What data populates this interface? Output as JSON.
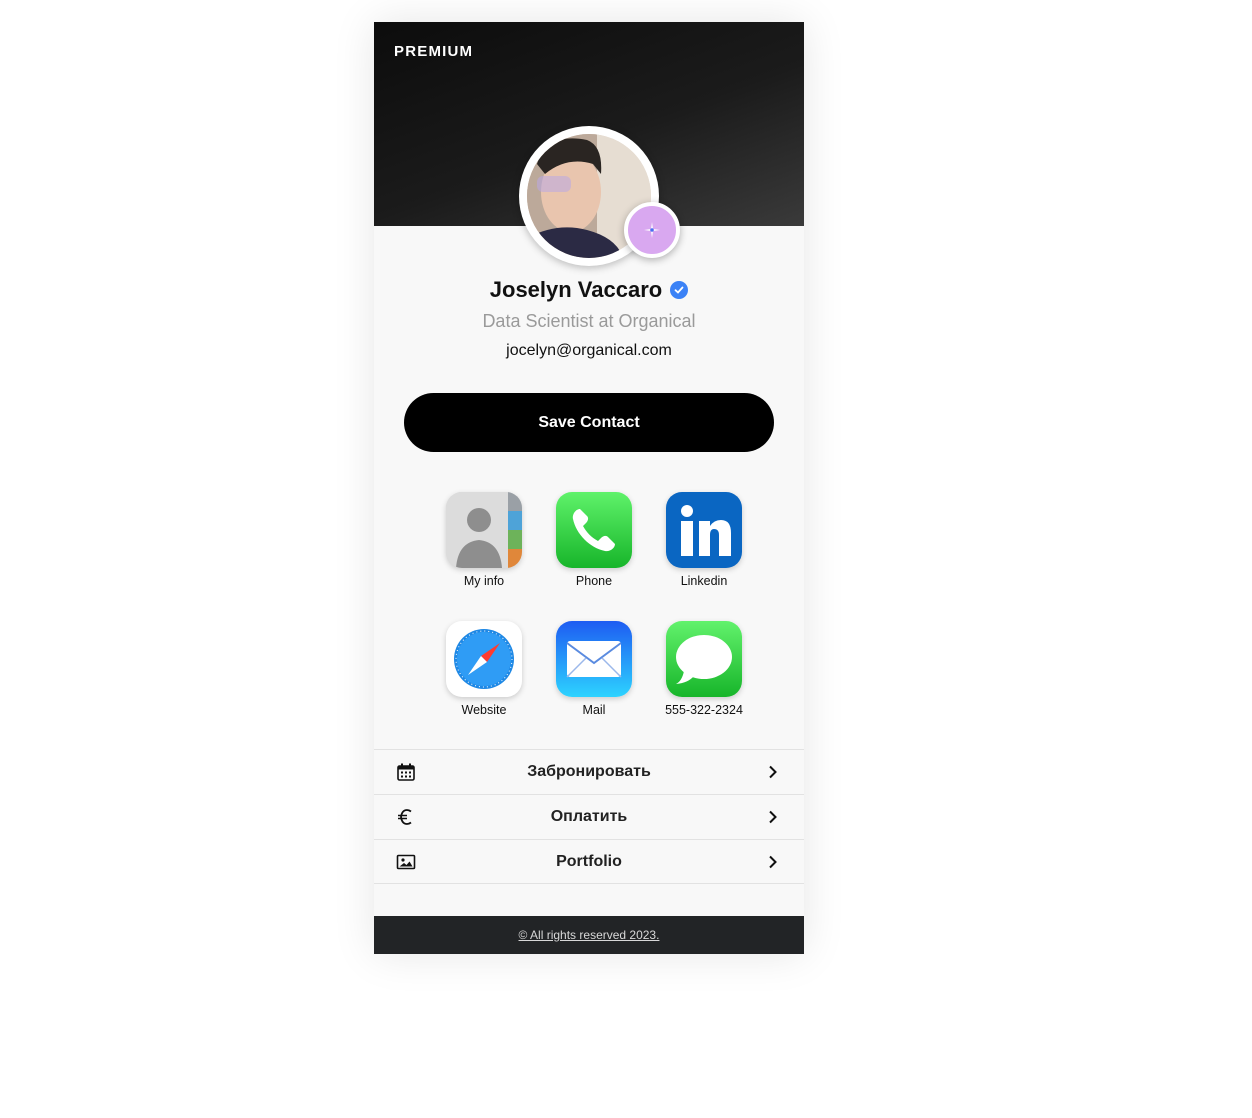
{
  "header": {
    "badge": "PREMIUM"
  },
  "profile": {
    "name": "Joselyn Vaccaro",
    "title": "Data Scientist at Organical",
    "email": "jocelyn@organical.com"
  },
  "actions": {
    "save_label": "Save Contact"
  },
  "apps": [
    {
      "label": "My info",
      "icon": "contacts-icon"
    },
    {
      "label": "Phone",
      "icon": "phone-icon"
    },
    {
      "label": "Linkedin",
      "icon": "linkedin-icon"
    },
    {
      "label": "Website",
      "icon": "safari-icon"
    },
    {
      "label": "Mail",
      "icon": "mail-icon"
    },
    {
      "label": "555-322-2324",
      "icon": "messages-icon"
    }
  ],
  "menu": [
    {
      "label": "Забронировать",
      "icon": "calendar-icon"
    },
    {
      "label": "Оплатить",
      "icon": "euro-icon"
    },
    {
      "label": "Portfolio",
      "icon": "image-icon"
    }
  ],
  "footer": {
    "text": "© All rights reserved 2023."
  },
  "colors": {
    "accent": "#d9a8f0",
    "verified": "#3b82f6",
    "header": "#1b1b1b",
    "button": "#000000"
  }
}
